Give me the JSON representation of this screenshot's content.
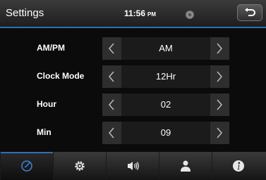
{
  "header": {
    "title": "Settings",
    "time": "11:56",
    "ampm": "PM",
    "icons": [
      "disc-icon",
      "back-icon"
    ]
  },
  "rows": [
    {
      "label": "AM/PM",
      "value": "AM"
    },
    {
      "label": "Clock Mode",
      "value": "12Hr"
    },
    {
      "label": "Hour",
      "value": "02"
    },
    {
      "label": "Min",
      "value": "09"
    }
  ],
  "tabbar": {
    "active_tab": "clock",
    "tabs": [
      {
        "icon": "clock-icon",
        "active": true
      },
      {
        "icon": "gear-icon",
        "active": false
      },
      {
        "icon": "speaker-icon",
        "active": false
      },
      {
        "icon": "person-icon",
        "active": false
      },
      {
        "icon": "info-icon",
        "active": false
      }
    ]
  },
  "colors": {
    "accent": "#2f6fb5",
    "background": "#0b0b0b",
    "text": "#ffffff"
  }
}
